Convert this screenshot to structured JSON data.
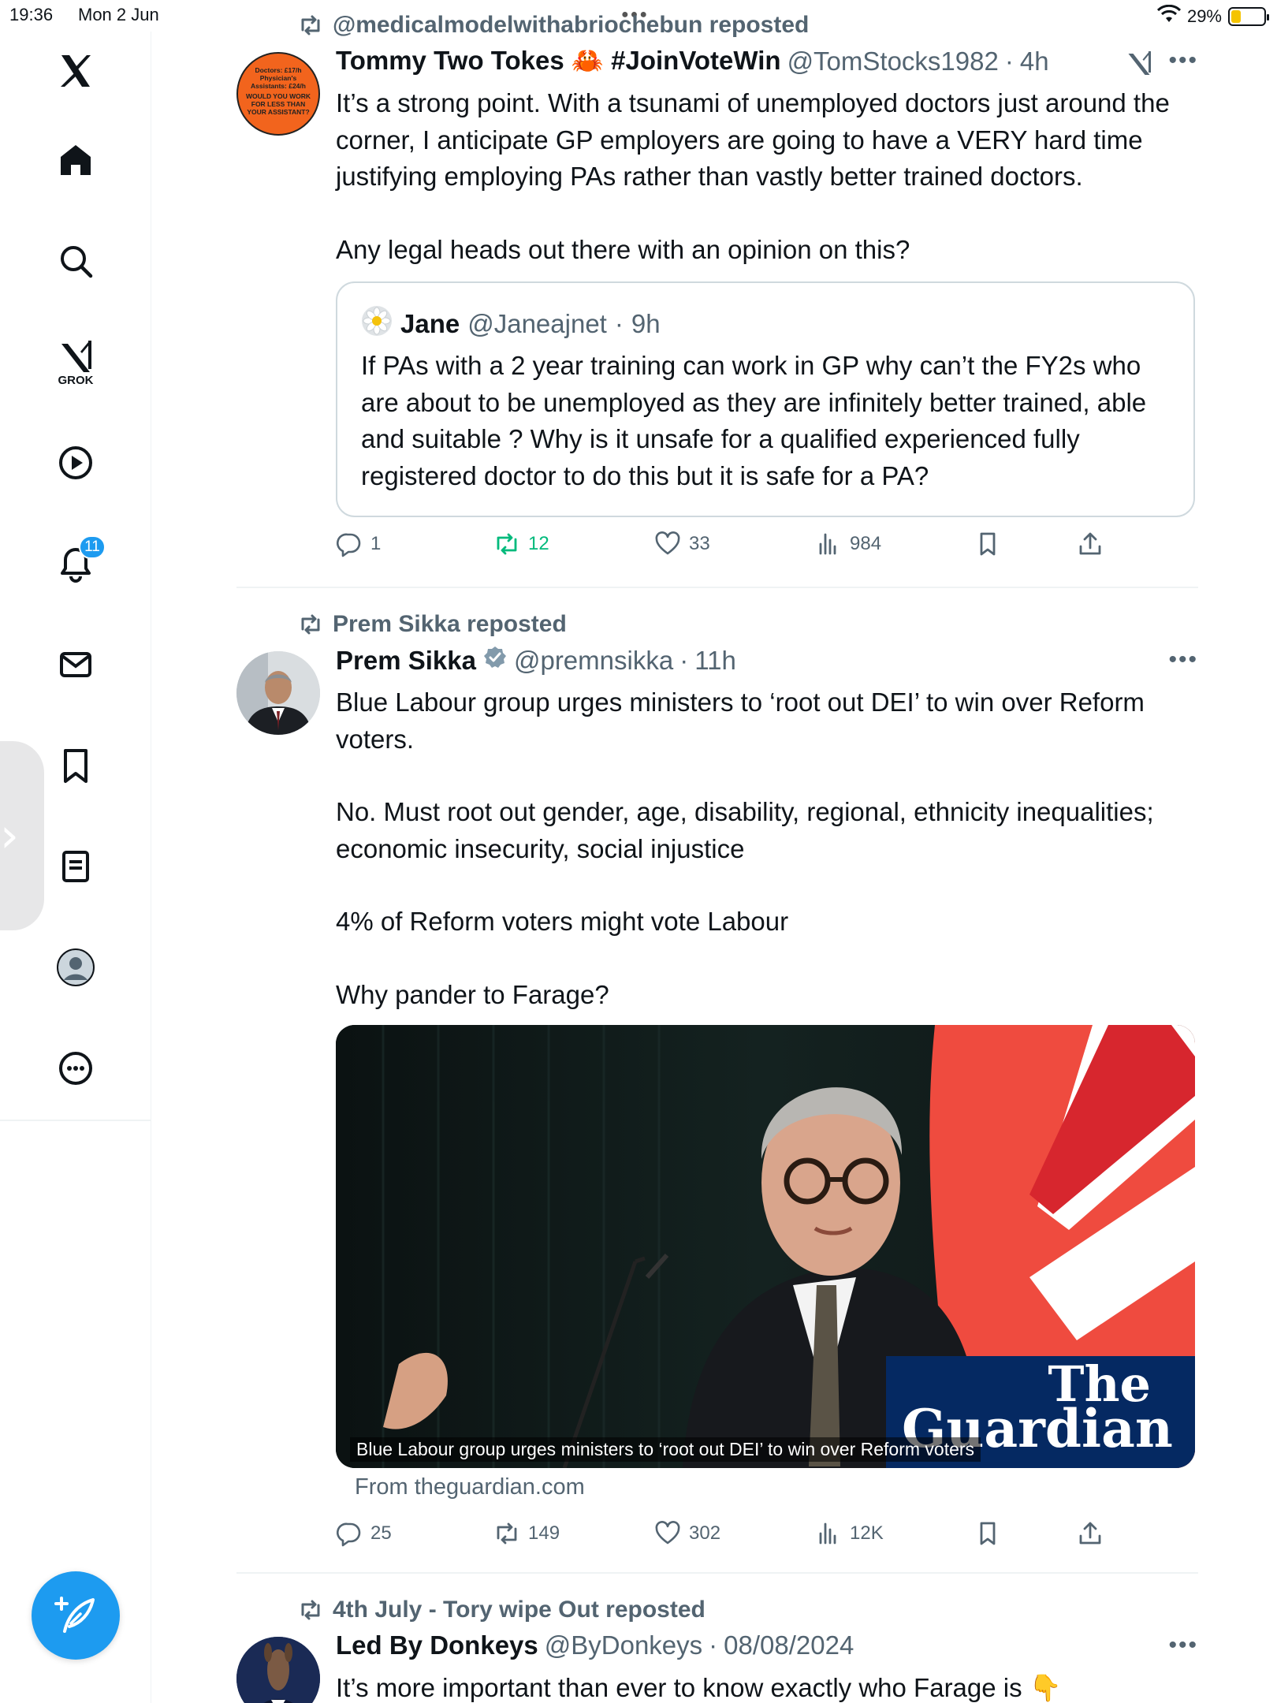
{
  "status_bar": {
    "time": "19:36",
    "date": "Mon 2 Jun",
    "battery": "29%",
    "battery_level": 0.29
  },
  "sidebar": {
    "grok_label": "GROK",
    "notifications_badge": "11"
  },
  "posts": [
    {
      "repost_label": "@medicalmodelwithabriochebun reposted",
      "author_name": "Tommy Two Tokes 🦀 #JoinVoteWin",
      "handle": "@TomStocks1982",
      "time": "4h",
      "avatar_text": [
        "Doctors: £17/h",
        "Physician's",
        "Assistants: £24/h",
        "WOULD YOU WORK",
        "FOR LESS THAN",
        "YOUR ASSISTANT?"
      ],
      "paragraphs": [
        "It’s a strong point. With a tsunami of unemployed doctors just around the corner, I anticipate GP employers are going to have a VERY hard time justifying employing PAs rather than vastly better trained doctors.",
        "Any legal heads out there with an opinion on this?"
      ],
      "quote": {
        "author_name": "Jane",
        "handle": "@Janeajnet",
        "time": "9h",
        "text": "If PAs with a 2 year training can work in GP why can’t the FY2s who are about to be unemployed as they are infinitely better trained, able and suitable ? Why is it unsafe for a qualified experienced fully registered doctor to do this but it is safe for a PA?"
      },
      "actions": {
        "replies": "1",
        "reposts": "12",
        "likes": "33",
        "views": "984"
      }
    },
    {
      "repost_label": "Prem Sikka reposted",
      "author_name": "Prem Sikka",
      "handle": "@premnsikka",
      "time": "11h",
      "paragraphs": [
        "Blue Labour group urges ministers to ‘root out DEI’ to win over Reform voters.",
        "No. Must root out gender, age, disability, regional, ethnicity inequalities; economic insecurity, social injustice",
        "4% of Reform voters might vote Labour",
        "Why pander to Farage?"
      ],
      "card": {
        "caption": "Blue Labour group urges ministers to ‘root out DEI’ to win over Reform voters",
        "brand_line1": "The",
        "brand_line2": "Guardian",
        "source": "From theguardian.com"
      },
      "actions": {
        "replies": "25",
        "reposts": "149",
        "likes": "302",
        "views": "12K"
      }
    },
    {
      "repost_label": "4th July - Tory wipe Out reposted",
      "author_name": "Led By Donkeys",
      "handle": "@ByDonkeys",
      "time": "08/08/2024",
      "paragraphs": [
        "It’s more important than ever to know exactly who Farage is 👇"
      ]
    }
  ],
  "separator": "·",
  "colors": {
    "accent": "#1d9bf0",
    "repost_green": "#00ba7c",
    "secondary_text": "#536471",
    "guardian_blue": "#052962"
  }
}
